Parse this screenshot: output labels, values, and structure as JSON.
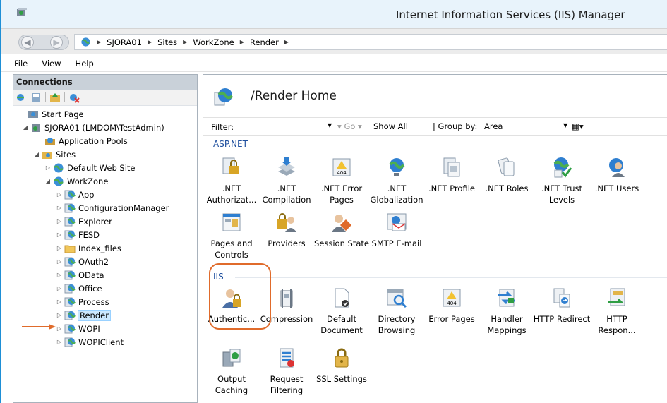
{
  "window": {
    "title": "Internet Information Services (IIS) Manager"
  },
  "address": {
    "crumbs": [
      "SJORA01",
      "Sites",
      "WorkZone",
      "Render"
    ]
  },
  "menu": {
    "items": [
      "File",
      "View",
      "Help"
    ]
  },
  "connections": {
    "header": "Connections",
    "tree": [
      {
        "label": "Start Page",
        "icon": "start-page-icon"
      },
      {
        "label": "SJORA01 (LMDOM\\TestAdmin)",
        "icon": "server-icon"
      },
      {
        "label": "Application Pools",
        "icon": "app-pools-icon"
      },
      {
        "label": "Sites",
        "icon": "sites-folder-icon"
      },
      {
        "label": "Default Web Site",
        "icon": "website-icon"
      },
      {
        "label": "WorkZone",
        "icon": "website-icon"
      },
      {
        "label": "App",
        "icon": "app-icon"
      },
      {
        "label": "ConfigurationManager",
        "icon": "app-icon"
      },
      {
        "label": "Explorer",
        "icon": "app-icon"
      },
      {
        "label": "FESD",
        "icon": "app-icon"
      },
      {
        "label": "Index_files",
        "icon": "folder-icon"
      },
      {
        "label": "OAuth2",
        "icon": "app-icon"
      },
      {
        "label": "OData",
        "icon": "app-icon"
      },
      {
        "label": "Office",
        "icon": "app-icon"
      },
      {
        "label": "Process",
        "icon": "app-icon"
      },
      {
        "label": "Render",
        "icon": "app-icon",
        "selected": true
      },
      {
        "label": "WOPI",
        "icon": "app-icon"
      },
      {
        "label": "WOPIClient",
        "icon": "app-icon"
      }
    ]
  },
  "content": {
    "title": "/Render Home",
    "filter": {
      "label": "Filter:",
      "go": "Go",
      "show_all": "Show All",
      "group_by_label": "Group by:",
      "group_by_value": "Area"
    },
    "groups": [
      {
        "name": "ASP.NET",
        "items": [
          {
            "label": ".NET Authorizat...",
            "icon": "net-authorization-icon"
          },
          {
            "label": ".NET Compilation",
            "icon": "net-compilation-icon"
          },
          {
            "label": ".NET Error Pages",
            "icon": "net-error-pages-icon"
          },
          {
            "label": ".NET Globalization",
            "icon": "net-globalization-icon"
          },
          {
            "label": ".NET Profile",
            "icon": "net-profile-icon"
          },
          {
            "label": ".NET Roles",
            "icon": "net-roles-icon"
          },
          {
            "label": ".NET Trust Levels",
            "icon": "net-trust-levels-icon"
          },
          {
            "label": ".NET Users",
            "icon": "net-users-icon"
          },
          {
            "label": "Pages and Controls",
            "icon": "pages-controls-icon"
          },
          {
            "label": "Providers",
            "icon": "providers-icon"
          },
          {
            "label": "Session State",
            "icon": "session-state-icon"
          },
          {
            "label": "SMTP E-mail",
            "icon": "smtp-email-icon"
          }
        ]
      },
      {
        "name": "IIS",
        "items": [
          {
            "label": "Authentic...",
            "icon": "authentication-icon"
          },
          {
            "label": "Compression",
            "icon": "compression-icon"
          },
          {
            "label": "Default Document",
            "icon": "default-document-icon"
          },
          {
            "label": "Directory Browsing",
            "icon": "directory-browsing-icon"
          },
          {
            "label": "Error Pages",
            "icon": "error-pages-icon"
          },
          {
            "label": "Handler Mappings",
            "icon": "handler-mappings-icon"
          },
          {
            "label": "HTTP Redirect",
            "icon": "http-redirect-icon"
          },
          {
            "label": "HTTP Respon...",
            "icon": "http-response-icon"
          },
          {
            "label": "Output Caching",
            "icon": "output-caching-icon"
          },
          {
            "label": "Request Filtering",
            "icon": "request-filtering-icon"
          },
          {
            "label": "SSL Settings",
            "icon": "ssl-settings-icon"
          }
        ]
      }
    ]
  },
  "colors": {
    "accent": "#1e8fd6",
    "highlight": "#e06b2b",
    "group": "#1e4f9e"
  }
}
